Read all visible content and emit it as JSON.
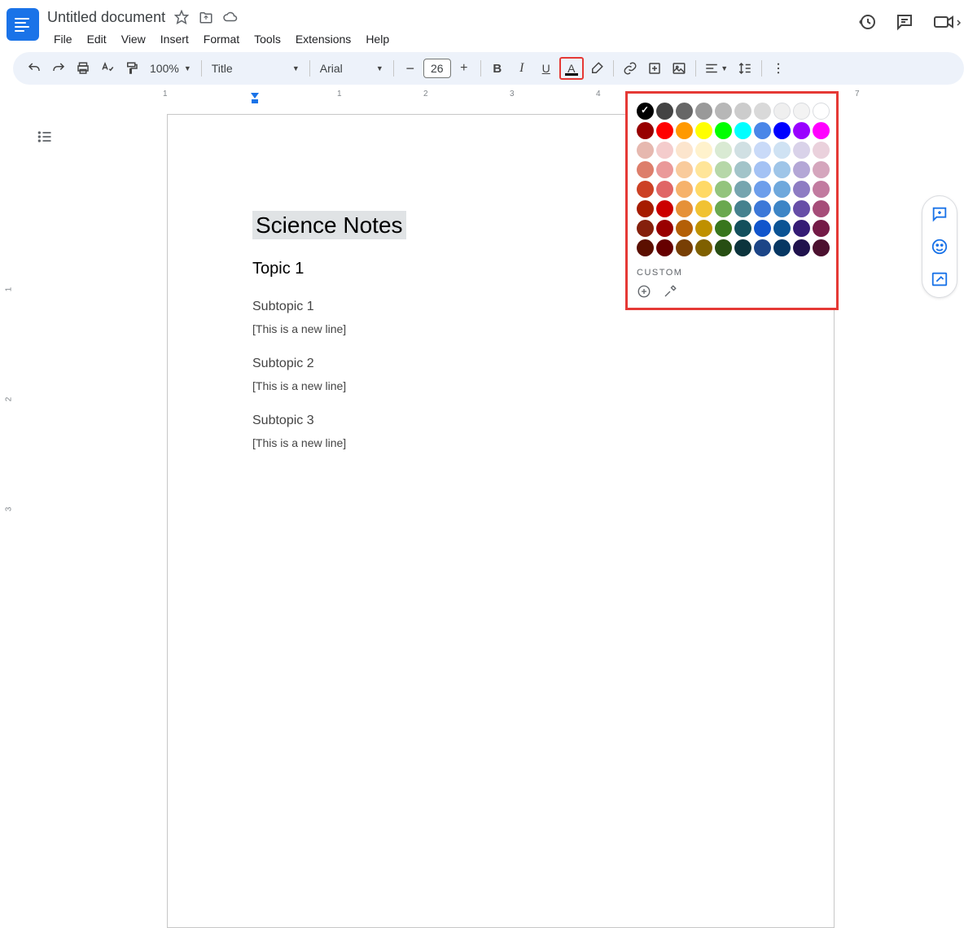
{
  "header": {
    "title": "Untitled document",
    "menus": [
      "File",
      "Edit",
      "View",
      "Insert",
      "Format",
      "Tools",
      "Extensions",
      "Help"
    ]
  },
  "toolbar": {
    "zoom": "100%",
    "style": "Title",
    "font": "Arial",
    "size": "26"
  },
  "ruler_h": [
    "1",
    "1",
    "2",
    "3",
    "4",
    "7"
  ],
  "ruler_v": [
    "1",
    "2",
    "3"
  ],
  "document": {
    "title": "Science Notes",
    "topic": "Topic 1",
    "sub1": "Subtopic 1",
    "line1": "[This is a new line]",
    "sub2": "Subtopic 2",
    "line2": "[This is a new line]",
    "sub3": "Subtopic 3",
    "line3": "[This is a new line]"
  },
  "color_picker": {
    "custom_label": "CUSTOM",
    "rows": [
      [
        "#000000",
        "#434343",
        "#666666",
        "#999999",
        "#b7b7b7",
        "#cccccc",
        "#d9d9d9",
        "#efefef",
        "#f3f3f3",
        "#ffffff"
      ],
      [
        "#980000",
        "#ff0000",
        "#ff9900",
        "#ffff00",
        "#00ff00",
        "#00ffff",
        "#4a86e8",
        "#0000ff",
        "#9900ff",
        "#ff00ff"
      ],
      [
        "#e6b8af",
        "#f4cccc",
        "#fce5cd",
        "#fff2cc",
        "#d9ead3",
        "#d0e0e3",
        "#c9daf8",
        "#cfe2f3",
        "#d9d2e9",
        "#ead1dc"
      ],
      [
        "#dd7e6b",
        "#ea9999",
        "#f9cb9c",
        "#ffe599",
        "#b6d7a8",
        "#a2c4c9",
        "#a4c2f4",
        "#9fc5e8",
        "#b4a7d6",
        "#d5a6bd"
      ],
      [
        "#cc4125",
        "#e06666",
        "#f6b26b",
        "#ffd966",
        "#93c47d",
        "#76a5af",
        "#6d9eeb",
        "#6fa8dc",
        "#8e7cc3",
        "#c27ba0"
      ],
      [
        "#a61c00",
        "#cc0000",
        "#e69138",
        "#f1c232",
        "#6aa84f",
        "#45818e",
        "#3c78d8",
        "#3d85c6",
        "#674ea7",
        "#a64d79"
      ],
      [
        "#85200c",
        "#990000",
        "#b45f06",
        "#bf9000",
        "#38761d",
        "#134f5c",
        "#1155cc",
        "#0b5394",
        "#351c75",
        "#741b47"
      ],
      [
        "#5b0f00",
        "#660000",
        "#783f04",
        "#7f6000",
        "#274e13",
        "#0c343d",
        "#1c4587",
        "#073763",
        "#20124d",
        "#4c1130"
      ]
    ],
    "checked": [
      0,
      0
    ]
  }
}
